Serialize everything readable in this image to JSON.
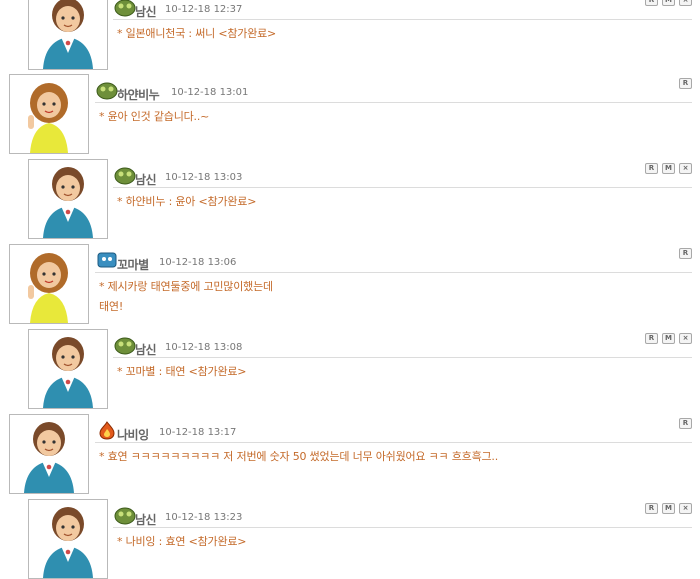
{
  "buttons": {
    "reply": "R",
    "modify": "M",
    "delete": "×"
  },
  "comments": [
    {
      "nickname": "남신",
      "date": "10-12-18 12:37",
      "text": "* 일본애니천국 : 써니 <참가완료>",
      "text2": ""
    },
    {
      "nickname": "하얀비누",
      "date": "10-12-18 13:01",
      "text": "* 윤아 인것 같습니다..~",
      "text2": ""
    },
    {
      "nickname": "남신",
      "date": "10-12-18 13:03",
      "text": "* 하얀비누 : 윤아 <참가완료>",
      "text2": ""
    },
    {
      "nickname": "꼬마별",
      "date": "10-12-18 13:06",
      "text": "* 제시카랑 태연둘중에 고민많이했는데",
      "text2": "태연!"
    },
    {
      "nickname": "남신",
      "date": "10-12-18 13:08",
      "text": "* 꼬마별 : 태연 <참가완료>",
      "text2": ""
    },
    {
      "nickname": "나비잉",
      "date": "10-12-18 13:17",
      "text": "* 효연 ㅋㅋㅋㅋㅋㅋㅋㅋㅋ 저 저번에 숫자 50 썼었는데 너무 아쉬웠어요 ㅋㅋ 흐흐흑그..",
      "text2": ""
    },
    {
      "nickname": "남신",
      "date": "10-12-18 13:23",
      "text": "* 나비잉 : 효연 <참가완료>",
      "text2": ""
    }
  ]
}
